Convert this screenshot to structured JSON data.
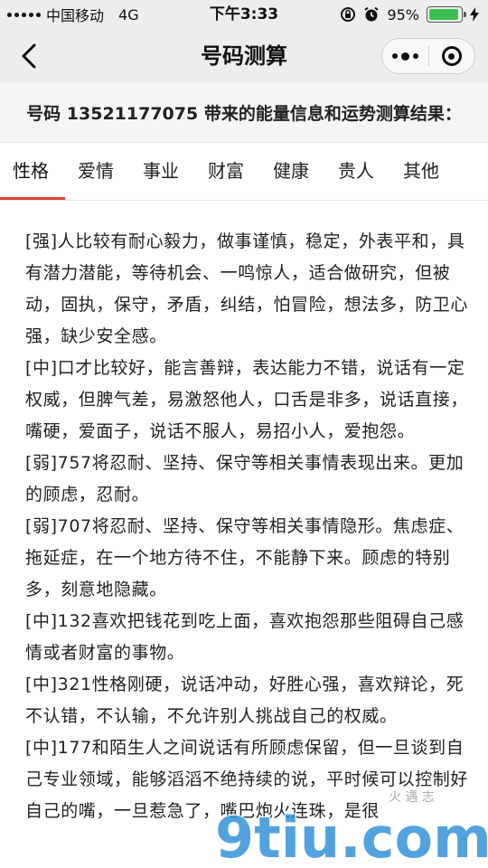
{
  "status_bar": {
    "carrier": "中国移动",
    "network": "4G",
    "time": "下午3:33",
    "battery_percent": "95%",
    "battery_level": 0.95
  },
  "nav": {
    "title": "号码测算"
  },
  "header": {
    "text": "号码 13521177075 带来的能量信息和运势测算结果："
  },
  "tabs": [
    {
      "label": "性格",
      "active": true
    },
    {
      "label": "爱情",
      "active": false
    },
    {
      "label": "事业",
      "active": false
    },
    {
      "label": "财富",
      "active": false
    },
    {
      "label": "健康",
      "active": false
    },
    {
      "label": "贵人",
      "active": false
    },
    {
      "label": "其他",
      "active": false
    }
  ],
  "content": {
    "paragraphs": [
      "[强]人比较有耐心毅力，做事谨慎，稳定，外表平和，具有潜力潜能，等待机会、一鸣惊人，适合做研究，但被动，固执，保守，矛盾，纠结，怕冒险，想法多，防卫心强，缺少安全感。",
      "[中]口才比较好，能言善辩，表达能力不错，说话有一定权威，但脾气差，易激怒他人，口舌是非多，说话直接，嘴硬，爱面子，说话不服人，易招小人，爱抱怨。",
      "[弱]757将忍耐、坚持、保守等相关事情表现出来。更加的顾虑，忍耐。",
      "[弱]707将忍耐、坚持、保守等相关事情隐形。焦虑症、拖延症，在一个地方待不住，不能静下来。顾虑的特别多，刻意地隐藏。",
      "[中]132喜欢把钱花到吃上面，喜欢抱怨那些阻碍自己感情或者财富的事物。",
      "[中]321性格刚硬，说话冲动，好胜心强，喜欢辩论，死不认错，不认输，不允许别人挑战自己的权威。",
      "[中]177和陌生人之间说话有所顾虑保留，但一旦谈到自己专业领域，能够滔滔不绝持续的说，平时候可以控制好自己的嘴，一旦惹急了，嘴巴炮火连珠，是很"
    ]
  },
  "watermark": {
    "text": "9tiu.com",
    "small_text": "火 遇 志"
  },
  "colors": {
    "accent": "#e04434",
    "bar_bg": "#ededed",
    "battery_green": "#3cc051",
    "watermark": "#2c8fd6"
  }
}
